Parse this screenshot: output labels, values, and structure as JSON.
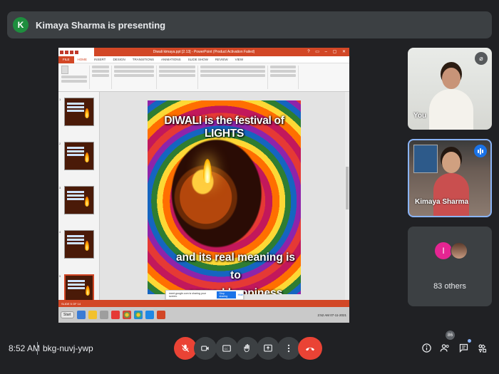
{
  "presenter": {
    "avatar_letter": "K",
    "banner_text": "Kimaya Sharma is presenting"
  },
  "powerpoint": {
    "doc_title": "Diwali kimaya.ppt [2.13] - PowerPoint (Product Activation Failed)",
    "file_tab": "FILE",
    "tabs": [
      "HOME",
      "INSERT",
      "DESIGN",
      "TRANSITIONS",
      "ANIMATIONS",
      "SLIDE SHOW",
      "REVIEW",
      "VIEW"
    ],
    "slide_numbers": [
      "1",
      "2",
      "3",
      "4",
      "5",
      "6"
    ],
    "status_text": "SLIDE 5 OF 14",
    "share_notice": {
      "text": "meet.google.com is sharing your screen.",
      "stop": "Stop sharing",
      "hide": "Hide"
    },
    "taskbar_start": "Start",
    "clock": "2:52 AM 07-11-2021"
  },
  "slide": {
    "title": "DIWALI is the festival of LIGHTS",
    "subtitle_line1": "and its real meaning is to",
    "subtitle_line2": "spread happiness"
  },
  "participants": {
    "you_label": "You",
    "kimaya_label": "Kimaya Sharma",
    "others_avatar_letter": "I",
    "others_label": "83 others"
  },
  "bottom": {
    "time": "8:52 AM",
    "meeting_code": "bkg-nuvj-ywp",
    "people_count": "86"
  },
  "colors": {
    "accent_red": "#ea4335",
    "ppt_orange": "#d24726",
    "meet_bg": "#202124"
  }
}
